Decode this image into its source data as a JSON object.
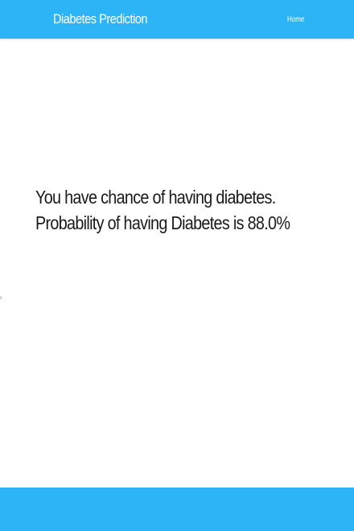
{
  "navbar": {
    "brand": "Diabetes Prediction",
    "links": [
      {
        "label": "Home"
      }
    ],
    "color": "#2cb4f7"
  },
  "main": {
    "result_text": "You have chance of having diabetes. Probability of having Diabetes is 88.0%",
    "probability_percent": 88.0
  },
  "side_mark": "͠",
  "footer": {
    "color": "#2cb4f7"
  }
}
